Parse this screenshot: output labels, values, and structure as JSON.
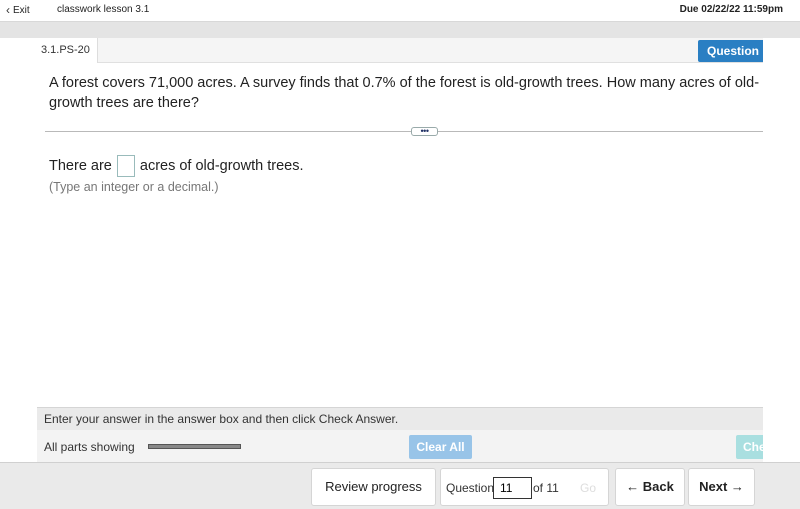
{
  "topbar": {
    "exit_label": "Exit",
    "lesson_title": "classwork lesson 3.1",
    "due": "Due 02/22/22 11:59pm"
  },
  "header": {
    "question_id": "3.1.PS-20",
    "help_label": "Question Help"
  },
  "question": {
    "text": "A forest covers 71,000 acres. A survey finds that 0.7% of the forest is old-growth trees. How many acres of old-growth trees are there?",
    "more_label": "•••",
    "answer_prefix": "There are",
    "answer_value": "",
    "answer_suffix": "acres of old-growth trees.",
    "hint": "(Type an integer or a decimal.)"
  },
  "instructions": "Enter your answer in the answer box and then click Check Answer.",
  "parts": {
    "label": "All parts showing",
    "clear_all_label": "Clear All",
    "check_answer_label": "Check Answer"
  },
  "footer": {
    "review_label": "Review progress",
    "question_label": "Question",
    "question_number": "11",
    "of_label": "of 11",
    "go_label": "Go",
    "back_label": "← Back",
    "next_label": "Next →"
  }
}
